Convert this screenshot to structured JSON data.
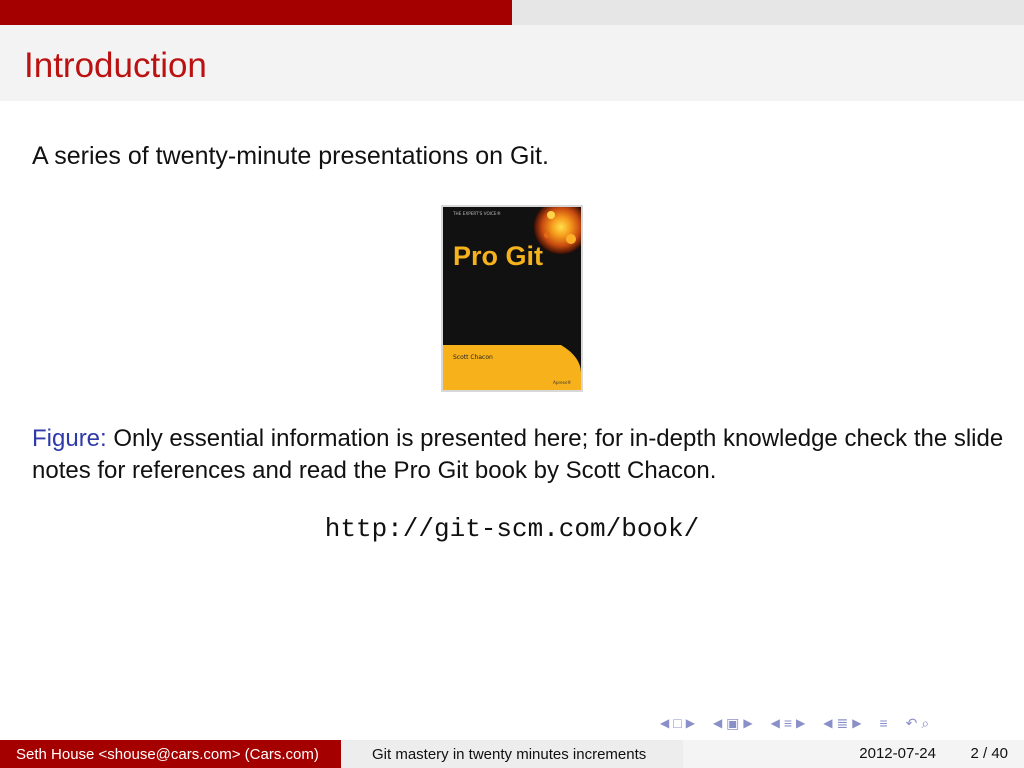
{
  "progress": {
    "fraction": 0.5
  },
  "slide": {
    "title": "Introduction",
    "intro": "A series of twenty-minute presentations on Git.",
    "book_cover": {
      "banner": "THE EXPERT'S VOICE®",
      "title": "Pro Git",
      "author": "Scott Chacon",
      "publisher": "Apress®"
    },
    "caption_label": "Figure:",
    "caption_text": "Only essential information is presented here; for in-depth knowledge check the slide notes for references and read the Pro Git book by Scott Chacon.",
    "url": "http://git-scm.com/book/"
  },
  "footer": {
    "author": "Seth House <shouse@cars.com> (Cars.com)",
    "title": "Git mastery in twenty minutes increments",
    "date": "2012-07-24",
    "page": "2 / 40"
  },
  "colors": {
    "accent": "#a50000",
    "title": "#bb1111",
    "caption_label": "#2e3aa8",
    "nav_icons": "#8a8fc8"
  },
  "nav_icons": [
    "nav-frame-icon",
    "nav-subsection-icon",
    "nav-section-icon",
    "nav-document-icon",
    "nav-outline-icon",
    "nav-search-icon"
  ]
}
